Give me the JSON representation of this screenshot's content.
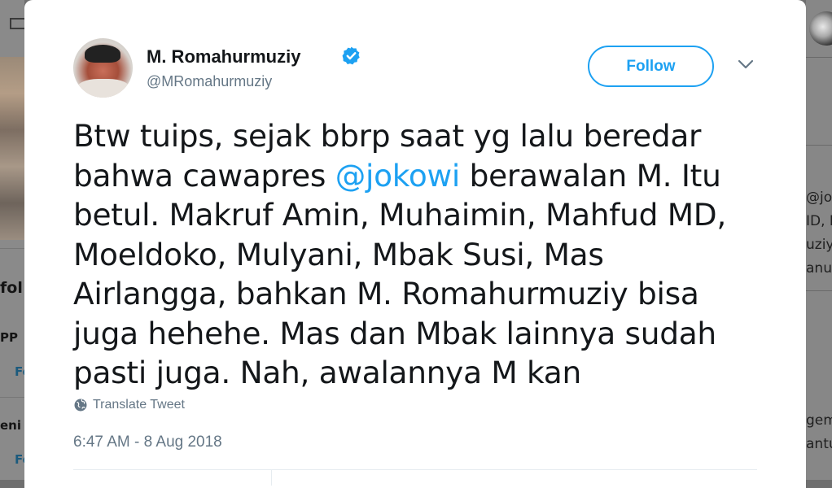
{
  "background": {
    "left_fragments": [
      "fol",
      "PP",
      "Fo",
      "eni",
      "Fo"
    ],
    "right_fragments": [
      "@jo",
      "ID, I",
      "uziy",
      "anu",
      "gem",
      "antu"
    ]
  },
  "tweet": {
    "author_name": "M. Romahurmuziy",
    "author_handle": "@MRomahurmuziy",
    "verified": true,
    "follow_label": "Follow",
    "text_lines": [
      "Btw tuips, sejak bbrp saat yg lalu beredar",
      "bahwa cawapres ",
      "@jokowi",
      " berawalan M. Itu",
      "betul. Makruf Amin, Muhaimin, Mahfud MD,",
      "Moeldoko, Mulyani, Mbak Susi, Mas",
      "Airlangga, bahkan M. Romahurmuziy bisa",
      "juga hehehe. Mas dan Mbak lainnya sudah",
      "pasti juga. Nah, awalannya M kan"
    ],
    "translate_label": "Translate Tweet",
    "timestamp": "6:47 AM - 8 Aug 2018"
  },
  "icons": {
    "verified": "verified-badge-icon",
    "caret": "chevron-down-icon",
    "globe": "globe-icon"
  },
  "colors": {
    "accent": "#1da1f2",
    "text": "#14171a",
    "muted": "#657786"
  }
}
